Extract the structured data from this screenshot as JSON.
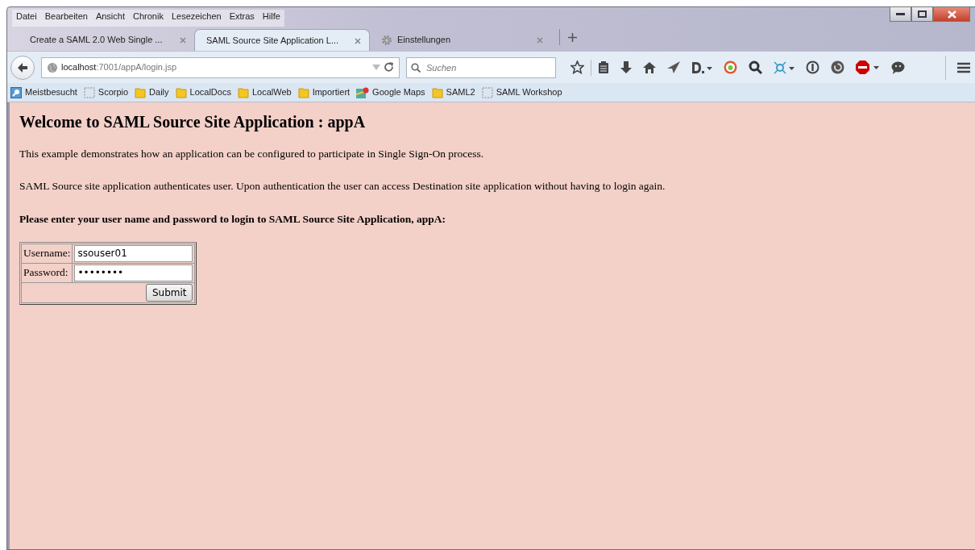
{
  "menu": [
    {
      "label": "Datei"
    },
    {
      "label": "Bearbeiten"
    },
    {
      "label": "Ansicht"
    },
    {
      "label": "Chronik"
    },
    {
      "label": "Lesezeichen"
    },
    {
      "label": "Extras"
    },
    {
      "label": "Hilfe"
    }
  ],
  "tabs": [
    {
      "label": "Create a SAML 2.0 Web Single ...",
      "kind": "page",
      "selected": false
    },
    {
      "label": "SAML Source Site Application L...",
      "kind": "page",
      "selected": true
    },
    {
      "label": "Einstellungen",
      "kind": "settings",
      "selected": false
    }
  ],
  "address": {
    "host": "localhost",
    "path": ":7001/appA/login.jsp"
  },
  "search": {
    "placeholder": "Suchen"
  },
  "bookmarks": [
    {
      "label": "Meistbesucht",
      "kind": "search"
    },
    {
      "label": "Scorpio",
      "kind": "empty"
    },
    {
      "label": "Daily",
      "kind": "folder"
    },
    {
      "label": "LocalDocs",
      "kind": "folder"
    },
    {
      "label": "LocalWeb",
      "kind": "folder"
    },
    {
      "label": "Importiert",
      "kind": "folder"
    },
    {
      "label": "Google Maps",
      "kind": "maps"
    },
    {
      "label": "SAML2",
      "kind": "folder"
    },
    {
      "label": "SAML Workshop",
      "kind": "empty"
    }
  ],
  "page": {
    "heading": "Welcome to SAML Source Site Application : appA",
    "paragraphs": [
      "This example demonstrates how an application can be configured to participate in Single Sign-On process.",
      "SAML Source site application authenticates user. Upon authentication the user can access Destination site application without having to login again."
    ],
    "prompt": "Please enter your user name and password to login to SAML Source Site Application, appA:",
    "fields": [
      {
        "label": "Username:",
        "value": "ssouser01"
      },
      {
        "label": "Password:",
        "value": "••••••••"
      }
    ],
    "submit": "Submit"
  }
}
